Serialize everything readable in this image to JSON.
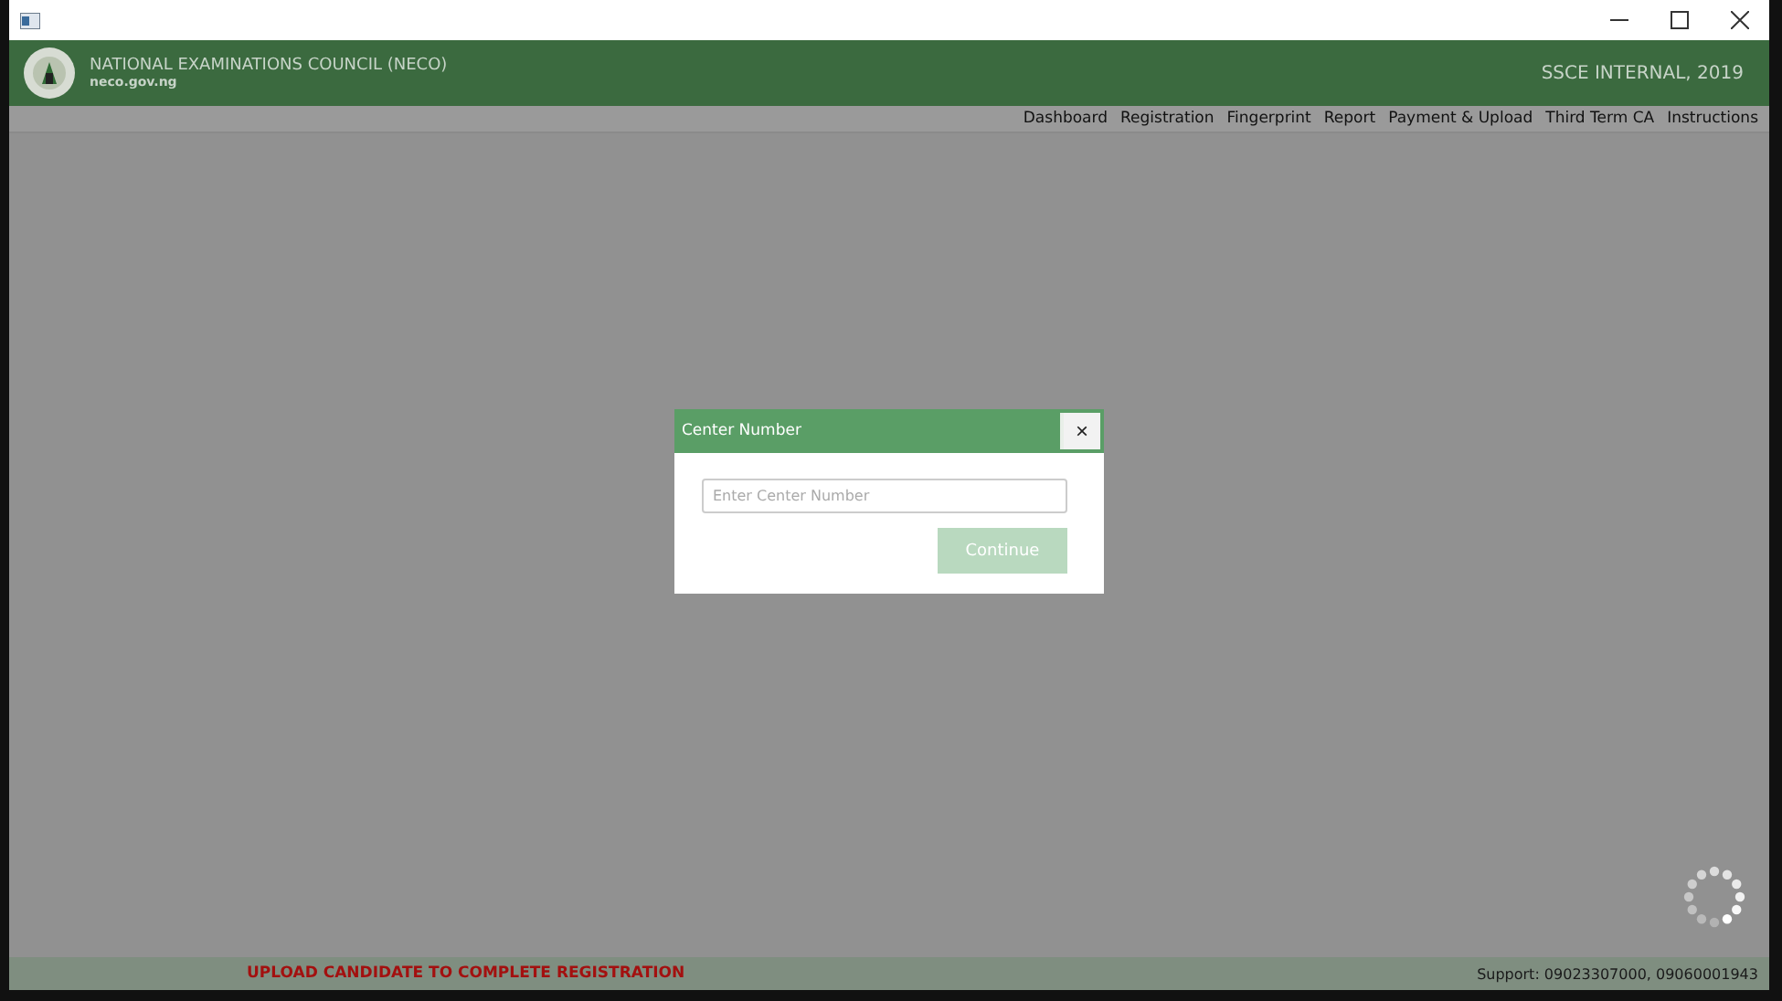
{
  "header": {
    "title": "NATIONAL EXAMINATIONS COUNCIL (NECO)",
    "subtitle": "neco.gov.ng",
    "session": "SSCE INTERNAL, 2019"
  },
  "nav": [
    {
      "label": "Dashboard"
    },
    {
      "label": "Registration"
    },
    {
      "label": "Fingerprint"
    },
    {
      "label": "Report"
    },
    {
      "label": "Payment & Upload"
    },
    {
      "label": "Third Term CA"
    },
    {
      "label": "Instructions"
    }
  ],
  "dialog": {
    "title": "Center Number",
    "close": "×",
    "placeholder": "Enter Center Number",
    "button": {
      "label": "Continue",
      "disabled": true
    }
  },
  "status_bar": {
    "message": "UPLOAD CANDIDATE TO COMPLETE REGISTRATION",
    "support": "Support: 09023307000, 09060001943"
  }
}
